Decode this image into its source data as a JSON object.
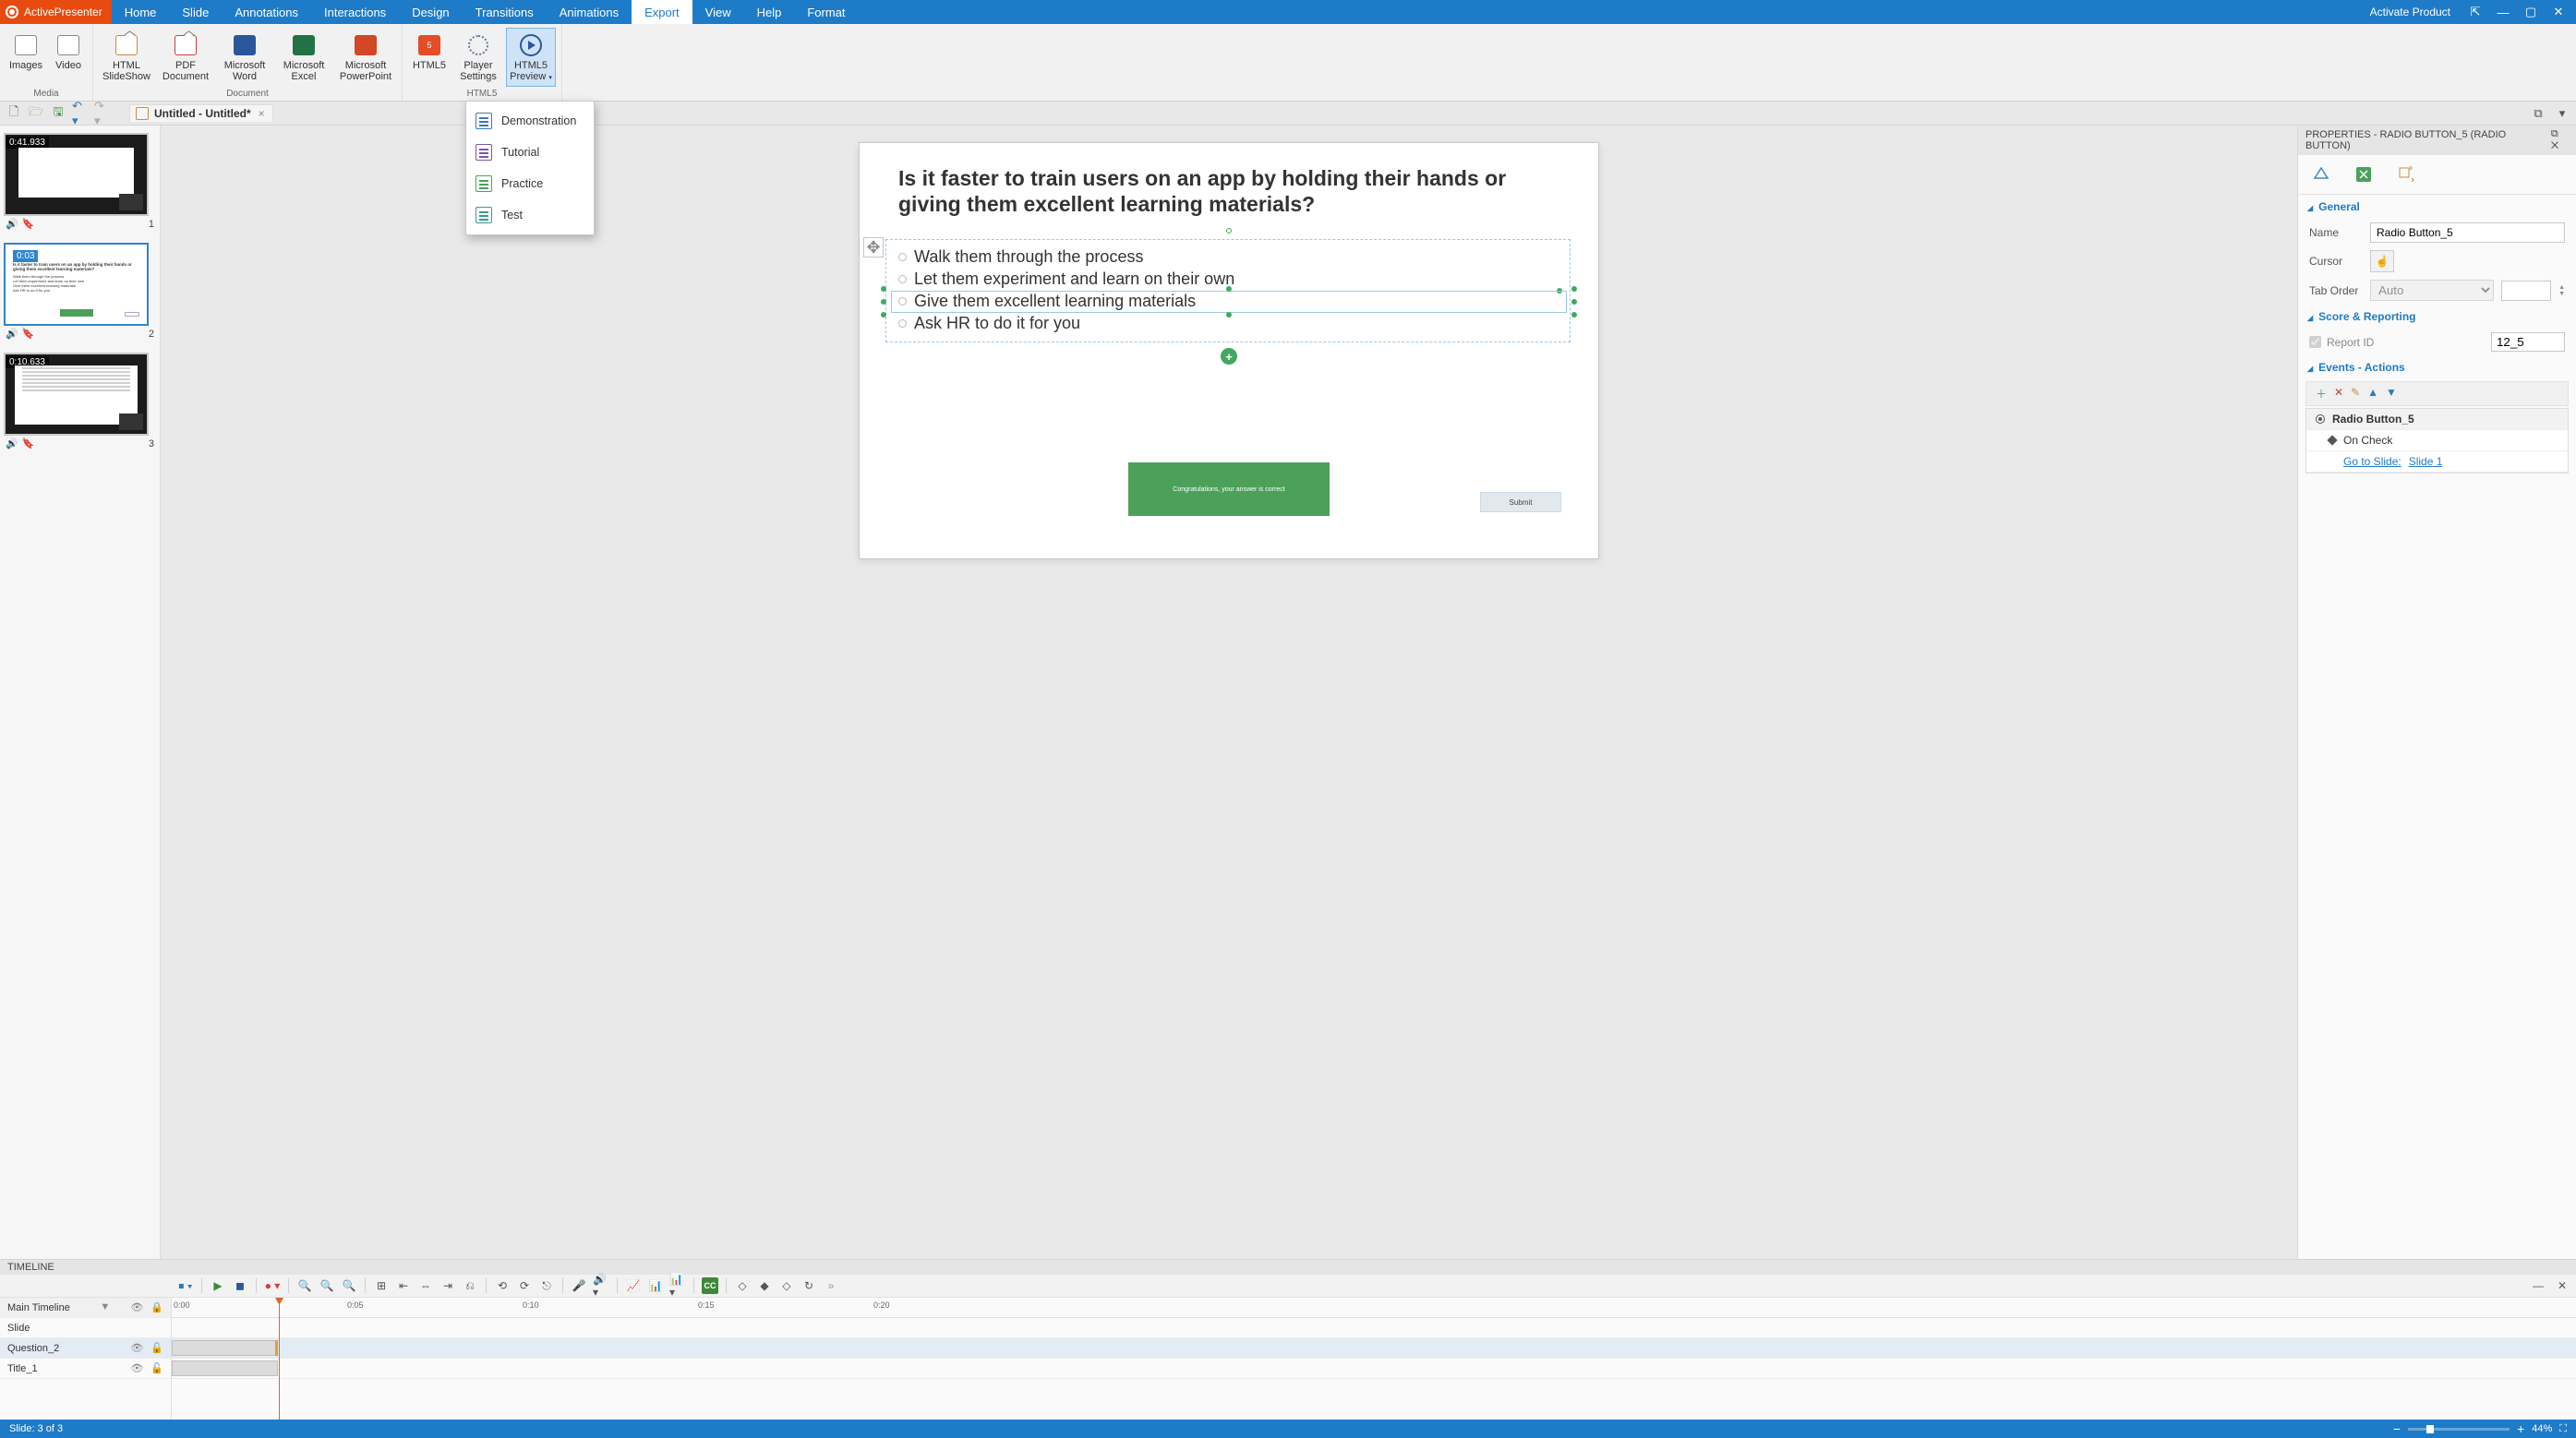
{
  "app": {
    "name": "ActivePresenter",
    "activate": "Activate Product"
  },
  "menu_tabs": [
    "Home",
    "Slide",
    "Annotations",
    "Interactions",
    "Design",
    "Transitions",
    "Animations",
    "Export",
    "View",
    "Help",
    "Format"
  ],
  "active_tab": "Export",
  "ribbon": {
    "media": {
      "label": "Media",
      "images": "Images",
      "video": "Video"
    },
    "document": {
      "label": "Document",
      "html_slideshow": "HTML SlideShow",
      "pdf": "PDF Document",
      "word": "Microsoft Word",
      "excel": "Microsoft Excel",
      "ppt": "Microsoft PowerPoint"
    },
    "html5": {
      "label": "HTML5",
      "html5": "HTML5",
      "player": "Player Settings",
      "preview": "HTML5 Preview"
    }
  },
  "preview_menu": [
    "Demonstration",
    "Tutorial",
    "Practice",
    "Test"
  ],
  "document_tab": "Untitled - Untitled*",
  "thumbs": [
    {
      "time": "0:41.933",
      "num": "1"
    },
    {
      "time": "0:03",
      "num": "2"
    },
    {
      "time": "0:10.633",
      "num": "3"
    }
  ],
  "slide": {
    "question": "Is it faster to train users on an app by holding their hands or giving them excellent learning materials?",
    "options": [
      "Walk them through the process",
      "Let them experiment and learn on their own",
      "Give them excellent learning materials",
      "Ask HR to do it for you"
    ],
    "feedback": "Congratulations, your answer is correct",
    "submit": "Submit"
  },
  "properties": {
    "title": "PROPERTIES - RADIO BUTTON_5 (RADIO BUTTON)",
    "general": "General",
    "name_label": "Name",
    "name_value": "Radio Button_5",
    "cursor_label": "Cursor",
    "taborder_label": "Tab Order",
    "taborder_value": "Auto",
    "score": "Score & Reporting",
    "report_id_label": "Report ID",
    "report_id_value": "12_5",
    "events": "Events - Actions",
    "ev_object": "Radio Button_5",
    "ev_trigger": "On Check",
    "ev_action": "Go to Slide:",
    "ev_target": "Slide 1"
  },
  "timeline": {
    "title": "TIMELINE",
    "main": "Main Timeline",
    "rows": [
      "Slide",
      "Question_2",
      "Title_1"
    ],
    "ticks": [
      "0:00",
      "0:05",
      "0:10",
      "0:15",
      "0:20"
    ]
  },
  "status": {
    "slide": "Slide: 3 of 3",
    "zoom": "44%"
  }
}
